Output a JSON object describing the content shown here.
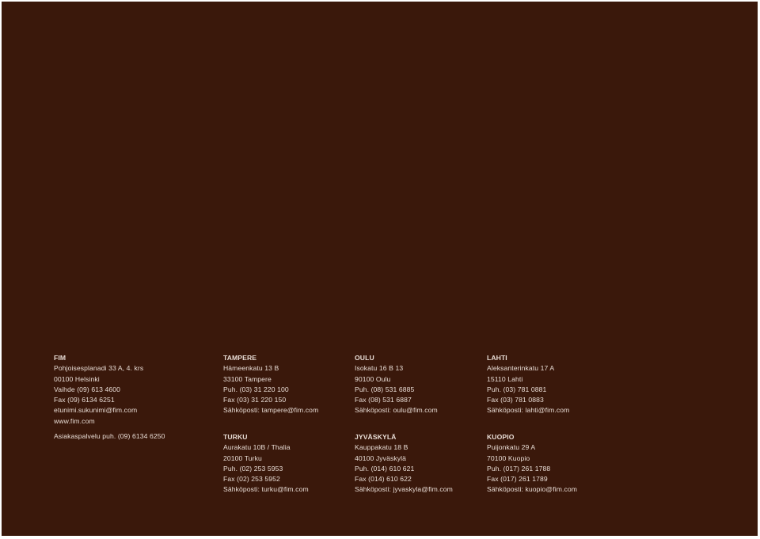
{
  "colors": {
    "background": "#3a180b",
    "text": "#e9ddd6"
  },
  "offices": {
    "fim": {
      "title": "FIM",
      "lines": [
        "Pohjoisesplanadi 33 A, 4. krs",
        "00100 Helsinki",
        "Vaihde (09) 613 4600",
        "Fax (09) 6134 6251",
        "etunimi.sukunimi@fim.com",
        "www.fim.com"
      ],
      "service_line": "Asiakaspalvelu puh. (09) 6134 6250"
    },
    "tampere": {
      "title": "TAMPERE",
      "lines": [
        "Hämeenkatu 13 B",
        "33100 Tampere",
        "Puh. (03) 31 220 100",
        "Fax (03) 31 220 150",
        "Sähköposti: tampere@fim.com"
      ]
    },
    "oulu": {
      "title": "OULU",
      "lines": [
        "Isokatu 16 B 13",
        "90100 Oulu",
        "Puh. (08) 531 6885",
        "Fax (08) 531 6887",
        "Sähköposti: oulu@fim.com"
      ]
    },
    "lahti": {
      "title": "LAHTI",
      "lines": [
        "Aleksanterinkatu 17 A",
        "15110 Lahti",
        "Puh. (03) 781 0881",
        "Fax (03) 781 0883",
        "Sähköposti: lahti@fim.com"
      ]
    },
    "turku": {
      "title": "TURKU",
      "lines": [
        "Aurakatu 10B / Thalia",
        "20100 Turku",
        "Puh. (02) 253 5953",
        "Fax (02) 253 5952",
        "Sähköposti: turku@fim.com"
      ]
    },
    "jyvaskyla": {
      "title": "JYVÄSKYLÄ",
      "lines": [
        "Kauppakatu 18 B",
        "40100 Jyväskylä",
        "Puh. (014) 610 621",
        "Fax (014) 610 622",
        "Sähköposti: jyvaskyla@fim.com"
      ]
    },
    "kuopio": {
      "title": "KUOPIO",
      "lines": [
        "Puijonkatu 29 A",
        "70100 Kuopio",
        "Puh. (017) 261 1788",
        "Fax (017) 261 1789",
        "Sähköposti: kuopio@fim.com"
      ]
    }
  }
}
